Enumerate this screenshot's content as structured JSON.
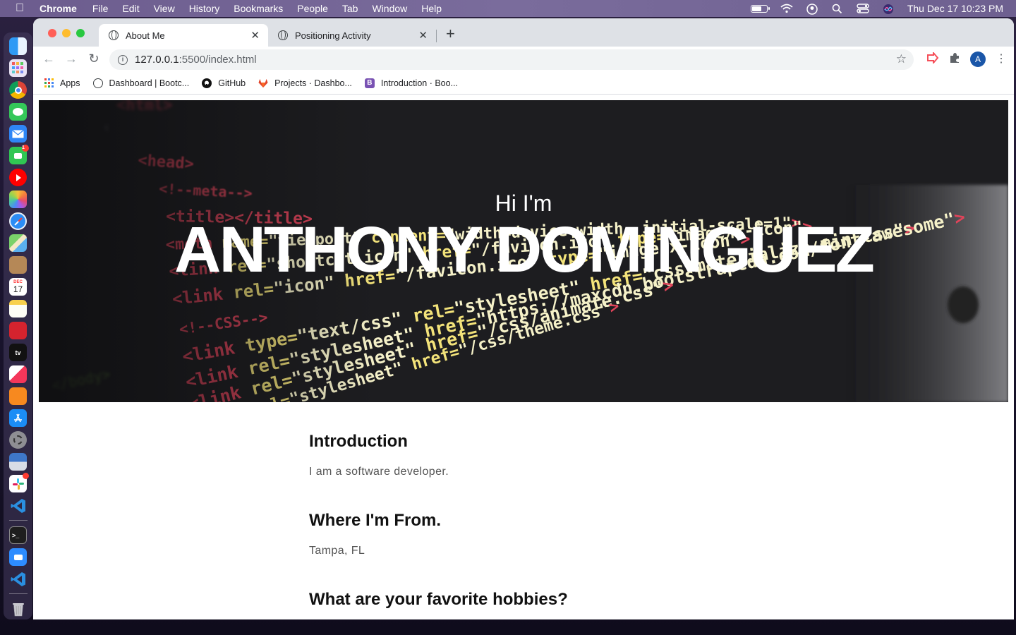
{
  "menubar": {
    "app_name": "Chrome",
    "items": [
      "File",
      "Edit",
      "View",
      "History",
      "Bookmarks",
      "People",
      "Tab",
      "Window",
      "Help"
    ],
    "clock": "Thu Dec 17  10:23 PM"
  },
  "dock": {
    "calendar_month": "DEC",
    "calendar_day": "17",
    "apple_tv_label": "tv"
  },
  "browser": {
    "tabs": [
      {
        "label": "About Me",
        "active": true
      },
      {
        "label": "Positioning Activity",
        "active": false
      }
    ],
    "url_host": "127.0.0.1",
    "url_path": ":5500/index.html",
    "avatar_letter": "A",
    "bookmarks": [
      {
        "label": "Apps",
        "icon": "apps-grid-icon"
      },
      {
        "label": "Dashboard | Bootc...",
        "icon": "globe-icon"
      },
      {
        "label": "GitHub",
        "icon": "github-icon"
      },
      {
        "label": "Projects · Dashbo...",
        "icon": "gitlab-icon"
      },
      {
        "label": "Introduction · Boo...",
        "icon": "bootstrap-icon",
        "icon_text": "B"
      }
    ]
  },
  "page": {
    "hero": {
      "greeting": "Hi I'm",
      "name": "ANTHONY DOMINGUEZ",
      "code_lines": [
        "<head>",
        "<!--meta-->",
        "<title></title>",
        "<meta name=\"viewport\" content=\"width=device-width, initial-scale=1\">",
        "<link rel=\"shortcut icon\" href=\"/favicon.ico\" type=\"image/x-icon\">",
        "<link rel=\"icon\" href=\"/favicon.ico\" type=\"image/x-icon\">",
        "<!--CSS-->",
        "<link type=\"text/css\" rel=\"stylesheet\" href=\"css/materialize.min.css\">",
        "<link rel=\"stylesheet\" href=\"https://maxcdn.bootstrapcdn.com/font-awesome\">",
        "<link rel=\"stylesheet\" href=\"/css/animate.css\">",
        "<link rel=\"stylesheet\" href=\"/css/theme.css\">"
      ]
    },
    "sections": [
      {
        "heading": "Introduction",
        "text": "I am a software developer."
      },
      {
        "heading": "Where I'm From.",
        "text": "Tampa, FL"
      },
      {
        "heading": "What are your favorite hobbies?",
        "text": ""
      }
    ]
  },
  "colors": {
    "accent_blue": "#1a56a8",
    "code_red": "#e0445a",
    "code_yellow": "#f3e37a",
    "code_green": "#8bd34a"
  }
}
